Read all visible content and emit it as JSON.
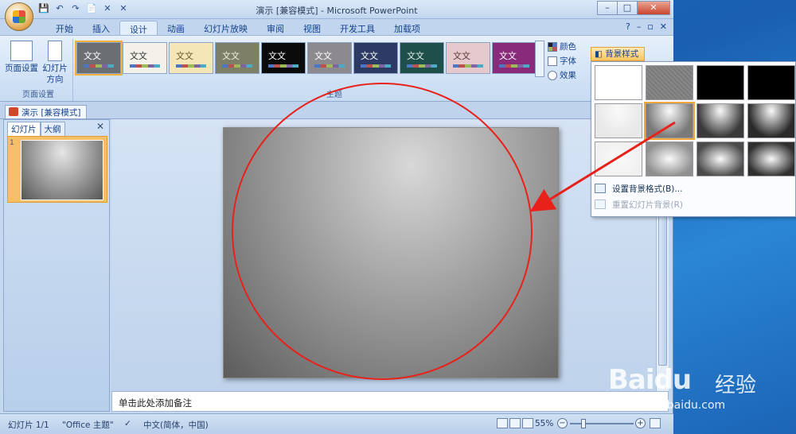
{
  "window": {
    "title": "演示 [兼容模式] - Microsoft PowerPoint",
    "controls": {
      "minimize": "–",
      "maximize": "□",
      "close": "✕"
    }
  },
  "quick_access": [
    "💾",
    "↶",
    "↷",
    "📄",
    "✕",
    "✕"
  ],
  "ribbon": {
    "tabs": [
      "开始",
      "插入",
      "设计",
      "动画",
      "幻灯片放映",
      "审阅",
      "视图",
      "开发工具",
      "加载项"
    ],
    "active_tab": "设计",
    "help": "?",
    "page_setup": {
      "page_setup_label": "页面设置",
      "orientation_label": "幻灯片\n方向",
      "group_label": "页面设置"
    },
    "themes": {
      "group_label": "主题",
      "items": [
        {
          "label": "文文",
          "bg": "#6b6f73",
          "fg": "#ffffff"
        },
        {
          "label": "文文",
          "bg": "#f4f1ea",
          "fg": "#333333"
        },
        {
          "label": "文文",
          "bg": "#f5e6b8",
          "fg": "#6b5a2a"
        },
        {
          "label": "文文",
          "bg": "#7d7f66",
          "fg": "#f0f0e0"
        },
        {
          "label": "文文",
          "bg": "#0b0b0b",
          "fg": "#ffffff"
        },
        {
          "label": "文文",
          "bg": "#8c8a8e",
          "fg": "#ffffff"
        },
        {
          "label": "文文",
          "bg": "#2d3a66",
          "fg": "#ffffff"
        },
        {
          "label": "文文",
          "bg": "#1f4f4a",
          "fg": "#e0f0e8"
        },
        {
          "label": "文文",
          "bg": "#e6c9cc",
          "fg": "#5a3a3e"
        },
        {
          "label": "文文",
          "bg": "#8a2a7a",
          "fg": "#ffffff"
        }
      ]
    },
    "options": {
      "colors": "颜色",
      "fonts": "字体",
      "effects": "效果",
      "background_style": "背景样式"
    }
  },
  "document_tab": "演示 [兼容模式]",
  "left_pane": {
    "tabs": [
      "幻灯片",
      "大纲"
    ],
    "close": "✕",
    "slide_number": "1"
  },
  "notes_placeholder": "单击此处添加备注",
  "statusbar": {
    "slide_info": "幻灯片 1/1",
    "theme": "\"Office 主题\"",
    "language": "中文(简体，中国)",
    "zoom": "55%",
    "zoom_out": "−",
    "zoom_in": "+"
  },
  "bg_menu": {
    "styles": [
      "#ffffff",
      "#8a8a8a",
      "#000000",
      "#000000",
      "#e8e8e8",
      "#7a7a7a",
      "#3a3a3a",
      "#2a2a2a",
      "#f0f0f0",
      "#8f8f8f",
      "#4a4a4a",
      "#2f2f2f"
    ],
    "format_label": "设置背景格式(B)...",
    "reset_label": "重置幻灯片背景(R)"
  },
  "watermark": {
    "brand": "Baidu",
    "brand_cn": "经验",
    "url": "jingyan.baidu.com"
  },
  "annotation_color": "#e8211b"
}
